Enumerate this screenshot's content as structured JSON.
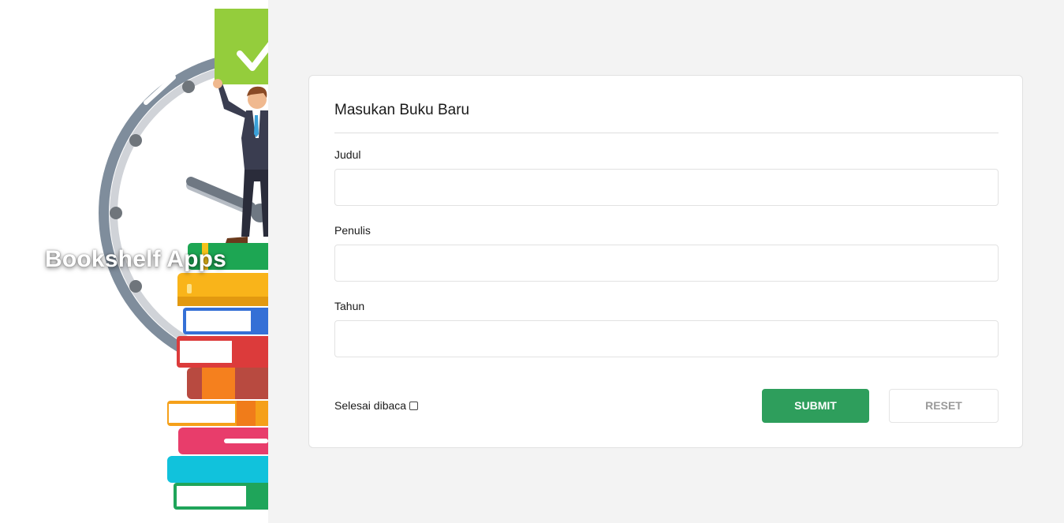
{
  "app": {
    "title": "Bookshelf Apps"
  },
  "form": {
    "heading": "Masukan Buku Baru",
    "fields": [
      {
        "label": "Judul",
        "value": "",
        "placeholder": ""
      },
      {
        "label": "Penulis",
        "value": "",
        "placeholder": ""
      },
      {
        "label": "Tahun",
        "value": "",
        "placeholder": ""
      }
    ],
    "checkbox": {
      "label": "Selesai dibaca",
      "checked": false
    },
    "submit_label": "SUBMIT",
    "reset_label": "RESET"
  },
  "colors": {
    "submit": "#2e9e5c",
    "page_background": "#f3f3f3",
    "accent_green": "#94cd3c"
  },
  "icons": {
    "illustration": "clock-businessman-books-illustration",
    "check": "check-icon"
  }
}
